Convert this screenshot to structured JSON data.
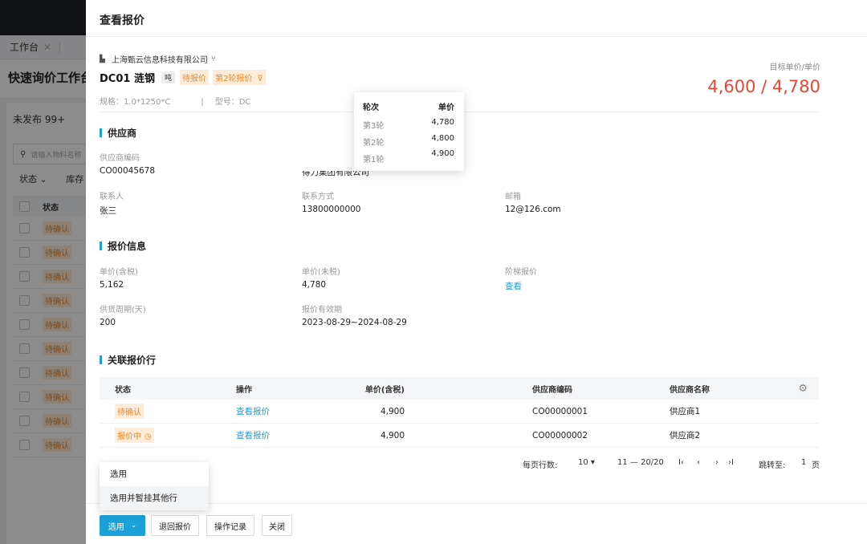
{
  "background": {
    "tab_label": "工作台",
    "tab_close": "✕",
    "page_title": "快速询价工作台",
    "unpublished_label": "未发布 99+",
    "search_placeholder": "请输入物料名称",
    "filter_status": "状态 ⌄",
    "filter_stock": "库存",
    "col_status": "状态",
    "rows": [
      "待确认",
      "待确认",
      "待确认",
      "待确认",
      "待确认",
      "待确认",
      "待确认",
      "待确认",
      "待确认",
      "待确认"
    ]
  },
  "drawer": {
    "title": "查看报价",
    "company": "上海甄云信息科技有限公司",
    "product_name": "DC01 涟钢",
    "unit_tag": "吨",
    "status_tag": "待报价",
    "round_tag": "第2轮报价",
    "spec": "规格：1.0*1250*C",
    "model": "型号：DC",
    "target_label": "目标单价/单价",
    "target_value": "4,600 / 4,780",
    "supplier": {
      "section_title": "供应商",
      "code_label": "供应商编码",
      "code_value": "CO00045678",
      "name_partial": "得力集团有限公司",
      "contact_label": "联系人",
      "contact_value": "张三",
      "phone_label": "联系方式",
      "phone_value": "13800000000",
      "email_label": "邮箱",
      "email_value": "12@126.com"
    },
    "quote": {
      "section_title": "报价信息",
      "price_tax_label": "单价(含税)",
      "price_tax_value": "5,162",
      "price_notax_label": "单价(未税)",
      "price_notax_value": "4,780",
      "tier_label": "阶梯报价",
      "tier_link": "查看",
      "cycle_label": "供货周期(天)",
      "cycle_value": "200",
      "validity_label": "报价有效期",
      "validity_value": "2023-08-29~2024-08-29"
    },
    "related": {
      "section_title": "关联报价行",
      "headers": [
        "状态",
        "操作",
        "单价(含税)",
        "供应商编码",
        "供应商名称"
      ],
      "rows": [
        {
          "status": "待确认",
          "action": "查看报价",
          "price": "4,900",
          "code": "CO00000001",
          "name": "供应商1"
        },
        {
          "status": "报价中",
          "action": "查看报价",
          "price": "4,900",
          "code": "CO00000002",
          "name": "供应商2"
        }
      ]
    },
    "pager": {
      "rows_label": "每页行数:",
      "rows_value": "10 ▾",
      "range": "11 — 20/20",
      "first": "I‹",
      "prev": "‹",
      "next": "›",
      "last": "›I",
      "jump_label": "跳转至:",
      "jump_value": "1",
      "jump_unit": "页"
    },
    "footer": {
      "select": "选用",
      "return": "退回报价",
      "log": "操作记录",
      "close": "关闭"
    },
    "menu": {
      "item1": "选用",
      "item2": "选用并暂挂其他行"
    },
    "popover": {
      "h_round": "轮次",
      "h_price": "单价",
      "rows": [
        {
          "round": "第3轮",
          "price": "4,780"
        },
        {
          "round": "第2轮",
          "price": "4,800"
        },
        {
          "round": "第1轮",
          "price": "4,900"
        }
      ]
    }
  },
  "colors": {
    "accent": "#1ba0d8",
    "warning": "#e98a2e",
    "warning_bg": "#fdecd9",
    "target_price": "#e9462f"
  }
}
